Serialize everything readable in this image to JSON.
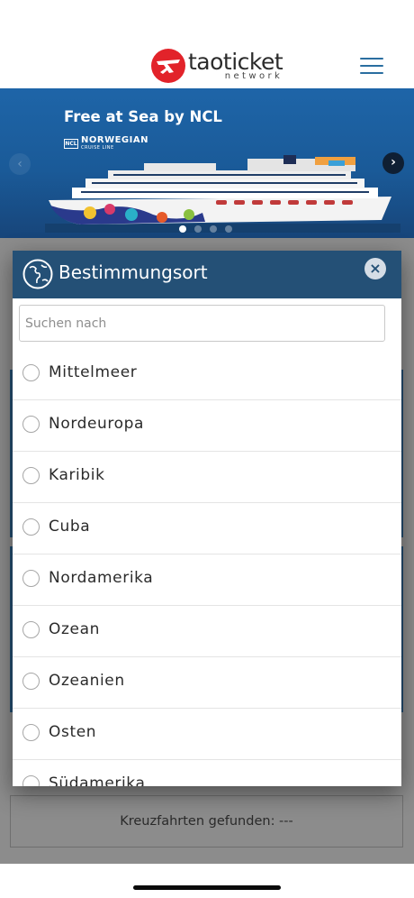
{
  "header": {
    "logo_name": "taoticket",
    "logo_sub": "network",
    "menu_icon": "hamburger-menu-icon",
    "accent_color": "#2a6ea0"
  },
  "banner": {
    "title": "Free at Sea by NCL",
    "brand_badge": "NCL",
    "brand_name": "NORWEGIAN",
    "brand_tagline": "CRUISE LINE",
    "prev_arrow": "‹",
    "next_arrow": "›",
    "slide_count": 4,
    "active_slide": 1
  },
  "modal": {
    "title": "Bestimmungsort",
    "header_color": "#245076",
    "close_label": "×",
    "search_placeholder": "Suchen nach",
    "search_value": "",
    "options": [
      {
        "label": "Mittelmeer",
        "selected": false
      },
      {
        "label": "Nordeuropa",
        "selected": false
      },
      {
        "label": "Karibik",
        "selected": false
      },
      {
        "label": "Cuba",
        "selected": false
      },
      {
        "label": "Nordamerika",
        "selected": false
      },
      {
        "label": "Ozean",
        "selected": false
      },
      {
        "label": "Ozeanien",
        "selected": false
      },
      {
        "label": "Osten",
        "selected": false
      },
      {
        "label": "Südamerika",
        "selected": false
      }
    ]
  },
  "results": {
    "label": "Kreuzfahrten gefunden: ---"
  }
}
